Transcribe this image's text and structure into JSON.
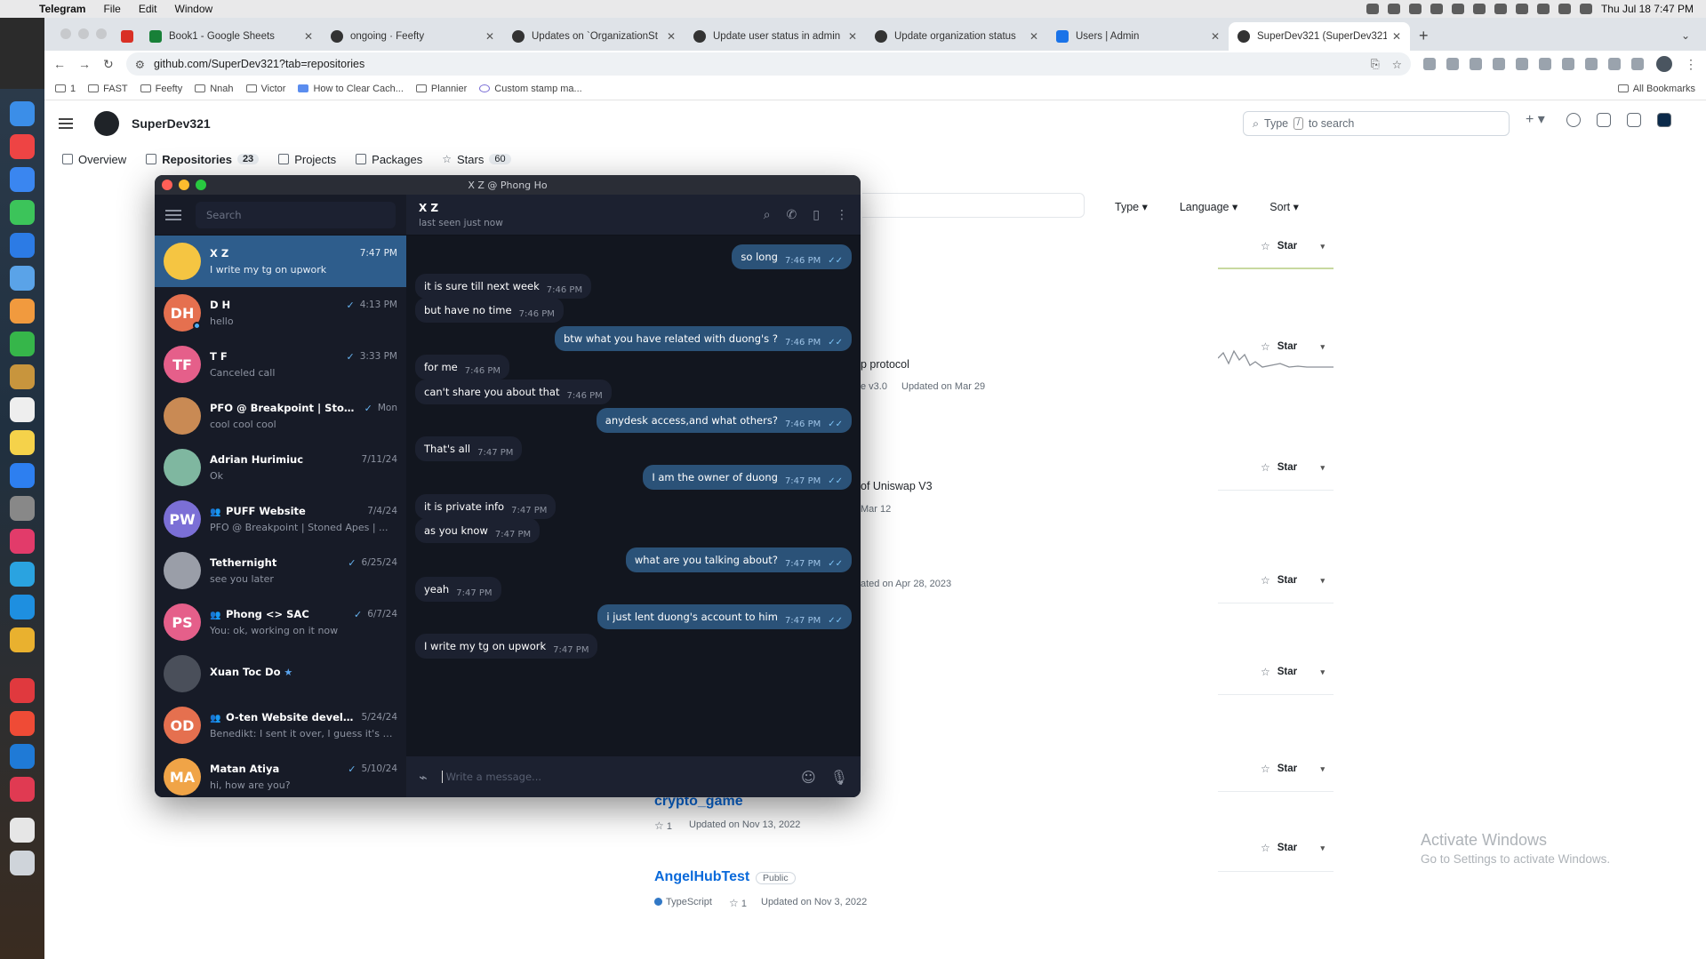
{
  "menubar": {
    "app": "Telegram",
    "items": [
      "File",
      "Edit",
      "Window"
    ],
    "clock": "Thu Jul 18  7:47 PM"
  },
  "browser": {
    "tabs": [
      {
        "title": "",
        "icon": "gmail-icon",
        "color": "#d93025"
      },
      {
        "title": "Book1 - Google Sheets",
        "icon": "sheets-icon",
        "color": "#188038"
      },
      {
        "title": "ongoing · Feefty",
        "icon": "github-icon",
        "color": "#333333"
      },
      {
        "title": "Updates on `OrganizationSt",
        "icon": "github-icon",
        "color": "#333333"
      },
      {
        "title": "Update user status in admin",
        "icon": "github-icon",
        "color": "#333333"
      },
      {
        "title": "Update organization status",
        "icon": "github-icon",
        "color": "#333333"
      },
      {
        "title": "Users | Admin",
        "icon": "admin-icon",
        "color": "#1a73e8"
      },
      {
        "title": "SuperDev321 (SuperDev321)",
        "icon": "github-icon",
        "color": "#333333",
        "active": true
      }
    ],
    "url": "github.com/SuperDev321?tab=repositories",
    "bookmarks": [
      "1",
      "FAST",
      "Feefty",
      "Nnah",
      "Victor",
      "How to Clear Cach...",
      "Plannier",
      "Custom stamp ma..."
    ],
    "all_bookmarks": "All Bookmarks"
  },
  "github": {
    "username": "SuperDev321",
    "search_placeholder": "Type",
    "search_slash": "/",
    "search_suffix": "to search",
    "tabs": [
      {
        "label": "Overview",
        "count": ""
      },
      {
        "label": "Repositories",
        "count": "23"
      },
      {
        "label": "Projects",
        "count": ""
      },
      {
        "label": "Packages",
        "count": ""
      },
      {
        "label": "Stars",
        "count": "60"
      }
    ],
    "filters": [
      "Type",
      "Language",
      "Sort"
    ],
    "star_label": "Star",
    "fragments": {
      "f1": "p protocol",
      "f1meta": "e v3.0",
      "f1upd": "Updated on Mar 29",
      "f2": "of Uniswap V3",
      "f2upd": "Mar 12",
      "f3upd": "ated on Apr 28, 2023",
      "f4name": "crypto_game",
      "f4stars": "1",
      "f4upd": "Updated on Nov 13, 2022"
    },
    "last_repo": {
      "name": "AngelHubTest",
      "visibility": "Public",
      "language": "TypeScript",
      "language_color": "#3178c6",
      "stars": "1",
      "updated": "Updated on Nov 3, 2022"
    },
    "activate": {
      "title": "Activate Windows",
      "subtitle": "Go to Settings to activate Windows."
    }
  },
  "telegram": {
    "window_title": "X Z @ Phong Ho",
    "search_placeholder": "Search",
    "chats": [
      {
        "name": "X Z",
        "time": "7:47 PM",
        "msg": "I write my tg on upwork",
        "initials": "",
        "color": "#f5c542",
        "active": true,
        "check": false,
        "group": false
      },
      {
        "name": "D H",
        "time": "4:13 PM",
        "msg": "hello",
        "initials": "DH",
        "color": "#e5704f",
        "check": true,
        "online": true,
        "group": false
      },
      {
        "name": "T F",
        "time": "3:33 PM",
        "msg": "Canceled call",
        "initials": "TF",
        "color": "#e55f8a",
        "check": true,
        "group": false
      },
      {
        "name": "PFO @ Breakpoint | Stone...",
        "time": "Mon",
        "msg": "cool cool cool",
        "initials": "",
        "color": "#c98a54",
        "check": true,
        "group": false
      },
      {
        "name": "Adrian Hurimiuc",
        "time": "7/11/24",
        "msg": "Ok",
        "initials": "",
        "color": "#7fb7a0",
        "check": false,
        "group": false
      },
      {
        "name": "PUFF Website",
        "time": "7/4/24",
        "msg": "PFO @ Breakpoint | Stoned Apes | ...",
        "initials": "PW",
        "color": "#7b6fd6",
        "check": false,
        "group": true
      },
      {
        "name": "Tethernight",
        "time": "6/25/24",
        "msg": "see you later",
        "initials": "",
        "color": "#9a9ea8",
        "check": true,
        "group": false
      },
      {
        "name": "Phong <> SAC",
        "time": "6/7/24",
        "msg": "You: ok, working on it now",
        "initials": "PS",
        "color": "#e55f8a",
        "check": true,
        "group": true
      },
      {
        "name": "Xuan Toc Do",
        "time": "",
        "msg": "",
        "initials": "",
        "color": "#4a4f5a",
        "check": false,
        "group": false,
        "verified": true
      },
      {
        "name": "O-ten Website develop...",
        "time": "5/24/24",
        "msg": "Benedikt: I sent it over, I guess it's g...",
        "initials": "OD",
        "color": "#e5704f",
        "check": false,
        "group": true
      },
      {
        "name": "Matan Atiya",
        "time": "5/10/24",
        "msg": "hi, how are you?",
        "initials": "MA",
        "color": "#f0a447",
        "check": true,
        "group": false
      }
    ],
    "header": {
      "name": "X Z",
      "status": "last seen just now"
    },
    "messages": [
      {
        "dir": "out",
        "text": "so long",
        "time": "7:46 PM"
      },
      {
        "dir": "in",
        "text": "it is sure till next week",
        "time": "7:46 PM"
      },
      {
        "dir": "in",
        "text": "but have no time",
        "time": "7:46 PM"
      },
      {
        "dir": "out",
        "text": "btw what you have related with duong's ?",
        "time": "7:46 PM"
      },
      {
        "dir": "in",
        "text": "for me",
        "time": "7:46 PM"
      },
      {
        "dir": "in",
        "text": "can't share you about that",
        "time": "7:46 PM"
      },
      {
        "dir": "out",
        "text": "anydesk access,and what others?",
        "time": "7:46 PM"
      },
      {
        "dir": "in",
        "text": "That's all",
        "time": "7:47 PM"
      },
      {
        "dir": "out",
        "text": "I am the owner of duong",
        "time": "7:47 PM"
      },
      {
        "dir": "in",
        "text": "it is private info",
        "time": "7:47 PM"
      },
      {
        "dir": "in",
        "text": "as you know",
        "time": "7:47 PM"
      },
      {
        "dir": "out",
        "text": "what are you talking about?",
        "time": "7:47 PM"
      },
      {
        "dir": "in",
        "text": "yeah",
        "time": "7:47 PM"
      },
      {
        "dir": "out",
        "text": "i just lent duong's account to him",
        "time": "7:47 PM"
      },
      {
        "dir": "in",
        "text": "I write my tg on upwork",
        "time": "7:47 PM"
      }
    ],
    "input_placeholder": "Write a message..."
  }
}
